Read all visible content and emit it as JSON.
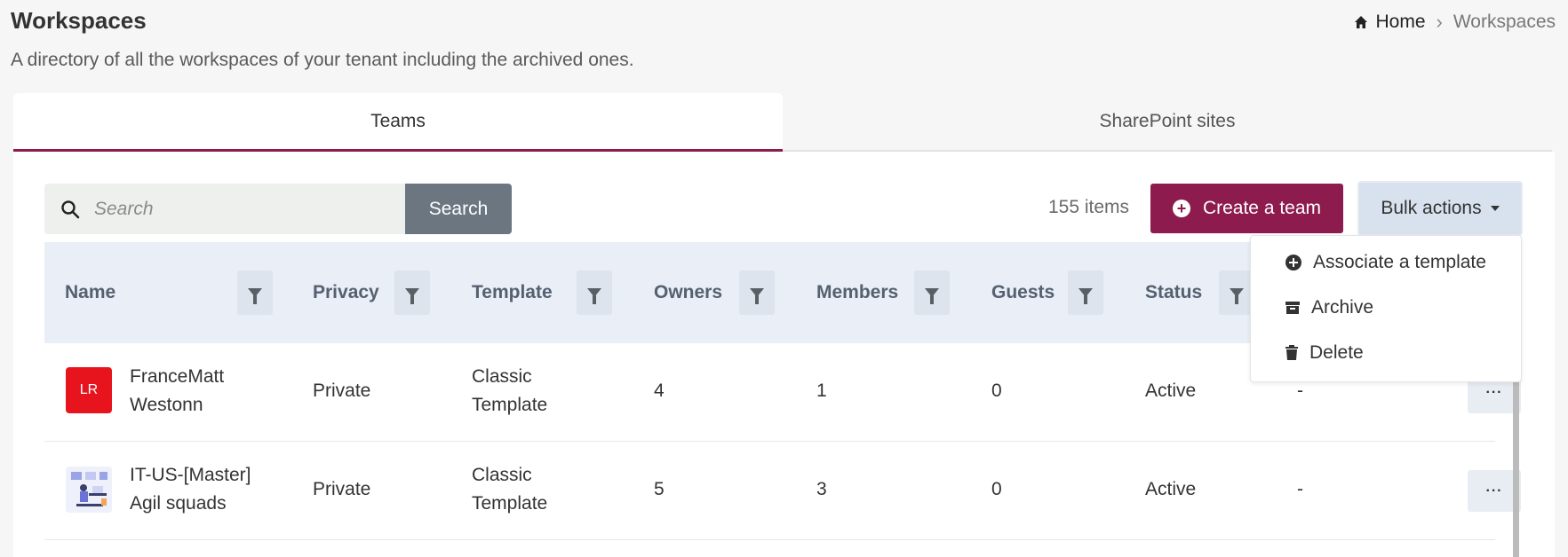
{
  "page": {
    "title": "Workspaces",
    "subtitle": "A directory of all the workspaces of your tenant including the archived ones."
  },
  "breadcrumb": {
    "home": "Home",
    "current": "Workspaces"
  },
  "tabs": [
    {
      "label": "Teams",
      "active": true
    },
    {
      "label": "SharePoint sites",
      "active": false
    }
  ],
  "search": {
    "placeholder": "Search",
    "button": "Search"
  },
  "item_count": "155 items",
  "create_button": "Create a team",
  "bulk_button": "Bulk actions",
  "bulk_menu": [
    "Associate a template",
    "Archive",
    "Delete"
  ],
  "columns": [
    "Name",
    "Privacy",
    "Template",
    "Owners",
    "Members",
    "Guests",
    "Status"
  ],
  "rows": [
    {
      "avatar_initials": "LR",
      "name_line1": "FranceMatt",
      "name_line2": "Westonn",
      "privacy": "Private",
      "template_line1": "Classic",
      "template_line2": "Template",
      "owners": "4",
      "members": "1",
      "guests": "0",
      "status": "Active",
      "extra": "-",
      "more": "···"
    },
    {
      "avatar_initials": "",
      "name_line1": "IT-US-[Master]",
      "name_line2": "Agil squads",
      "privacy": "Private",
      "template_line1": "Classic",
      "template_line2": "Template",
      "owners": "5",
      "members": "3",
      "guests": "0",
      "status": "Active",
      "extra": "-",
      "more": "···"
    }
  ],
  "colors": {
    "accent": "#8e1b4e",
    "header_bg": "#e9eef7",
    "avatar_red": "#e8141d"
  }
}
